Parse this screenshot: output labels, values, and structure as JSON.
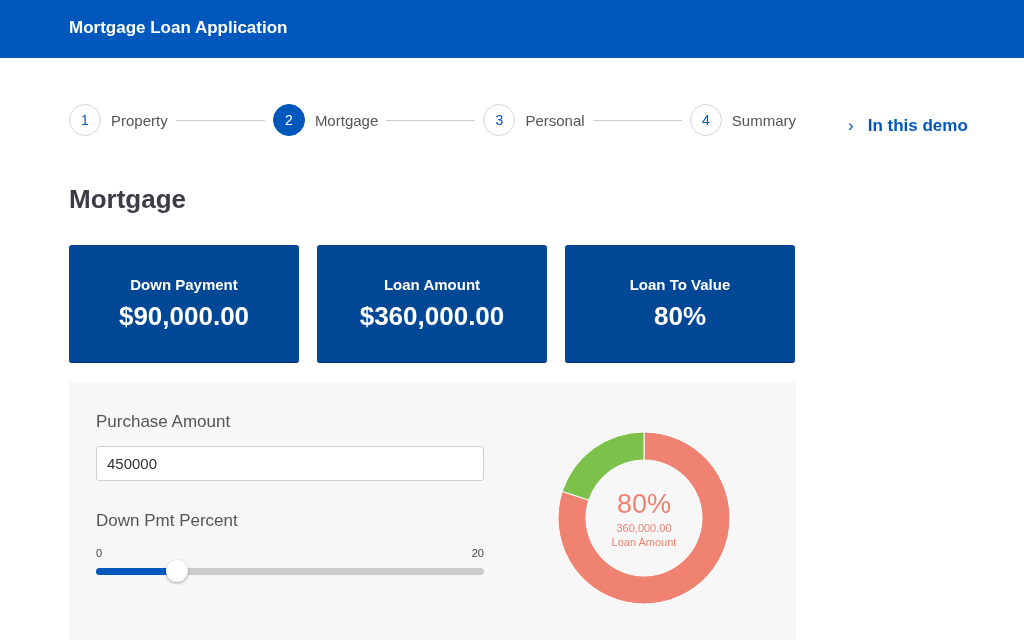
{
  "header": {
    "title": "Mortgage Loan Application"
  },
  "steps": [
    {
      "number": "1",
      "label": "Property",
      "selected": false
    },
    {
      "number": "2",
      "label": "Mortgage",
      "selected": true
    },
    {
      "number": "3",
      "label": "Personal",
      "selected": false
    },
    {
      "number": "4",
      "label": "Summary",
      "selected": false
    }
  ],
  "aside_link": {
    "icon": "›",
    "label": "In this demo"
  },
  "heading": "Mortgage",
  "cards": [
    {
      "label": "Down Payment",
      "value": "$90,000.00"
    },
    {
      "label": "Loan Amount",
      "value": "$360,000.00"
    },
    {
      "label": "Loan To Value",
      "value": "80%"
    }
  ],
  "form": {
    "purchase": {
      "label": "Purchase Amount",
      "value": "450000"
    },
    "down_pct": {
      "label": "Down Pmt Percent",
      "min_label": "0",
      "max_label": "20",
      "level": 0.21
    }
  },
  "donut": {
    "center_value": "80%",
    "center_amount": "360,000.00",
    "center_caption": "Loan Amount",
    "chart_data": {
      "type": "donut",
      "values": [
        80,
        20
      ],
      "colors": [
        "#ef8270",
        "#7bc14a"
      ]
    }
  }
}
